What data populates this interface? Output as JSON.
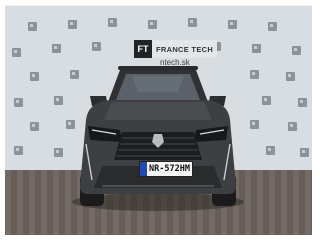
{
  "photo": {
    "subject": "Peugeot 3008",
    "background": {
      "logo_initials": "FT",
      "dealer_name": "FRANCE TECH",
      "domain_text": "ntech.sk"
    },
    "license_plate": "NR-572HM",
    "colors": {
      "car_body": "#3d3f42",
      "backdrop": "#d8dde1",
      "pavement": "#6c625c",
      "logo_box": "#1e2428"
    }
  }
}
